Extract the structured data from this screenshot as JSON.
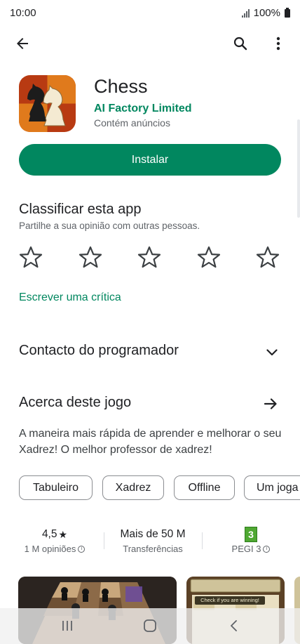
{
  "status_bar": {
    "time": "10:00",
    "battery": "100%"
  },
  "app": {
    "title": "Chess",
    "developer": "AI Factory Limited",
    "ads_note": "Contém anúncios",
    "install_label": "Instalar"
  },
  "rating_section": {
    "title": "Classificar esta app",
    "subtitle": "Partilhe a sua opinião com outras pessoas.",
    "star_count": 5,
    "write_review": "Escrever uma crítica"
  },
  "developer_contact": {
    "title": "Contacto do programador"
  },
  "about": {
    "title": "Acerca deste jogo",
    "description": "A maneira mais rápida de aprender e melhorar o seu Xadrez! O melhor professor de xadrez!"
  },
  "tags": [
    "Tabuleiro",
    "Xadrez",
    "Offline",
    "Um joga"
  ],
  "stats": {
    "rating": {
      "value": "4,5",
      "star": "★",
      "label": "1 M opiniões"
    },
    "downloads": {
      "value": "Mais de 50 M",
      "label": "Transferências"
    },
    "pegi": {
      "badge": "3",
      "label": "PEGI 3"
    }
  },
  "screenshot_2_text": {
    "banner": "Check if you are winning!"
  },
  "icons": {
    "back": "arrow-left-icon",
    "search": "search-icon",
    "more": "more-vert-icon",
    "chevron": "chevron-down-icon",
    "arrow": "arrow-right-icon",
    "info": "info-icon"
  },
  "colors": {
    "accent": "#01875f",
    "text_primary": "#202124",
    "text_secondary": "#5f6368",
    "pegi_green": "#4fa832"
  }
}
